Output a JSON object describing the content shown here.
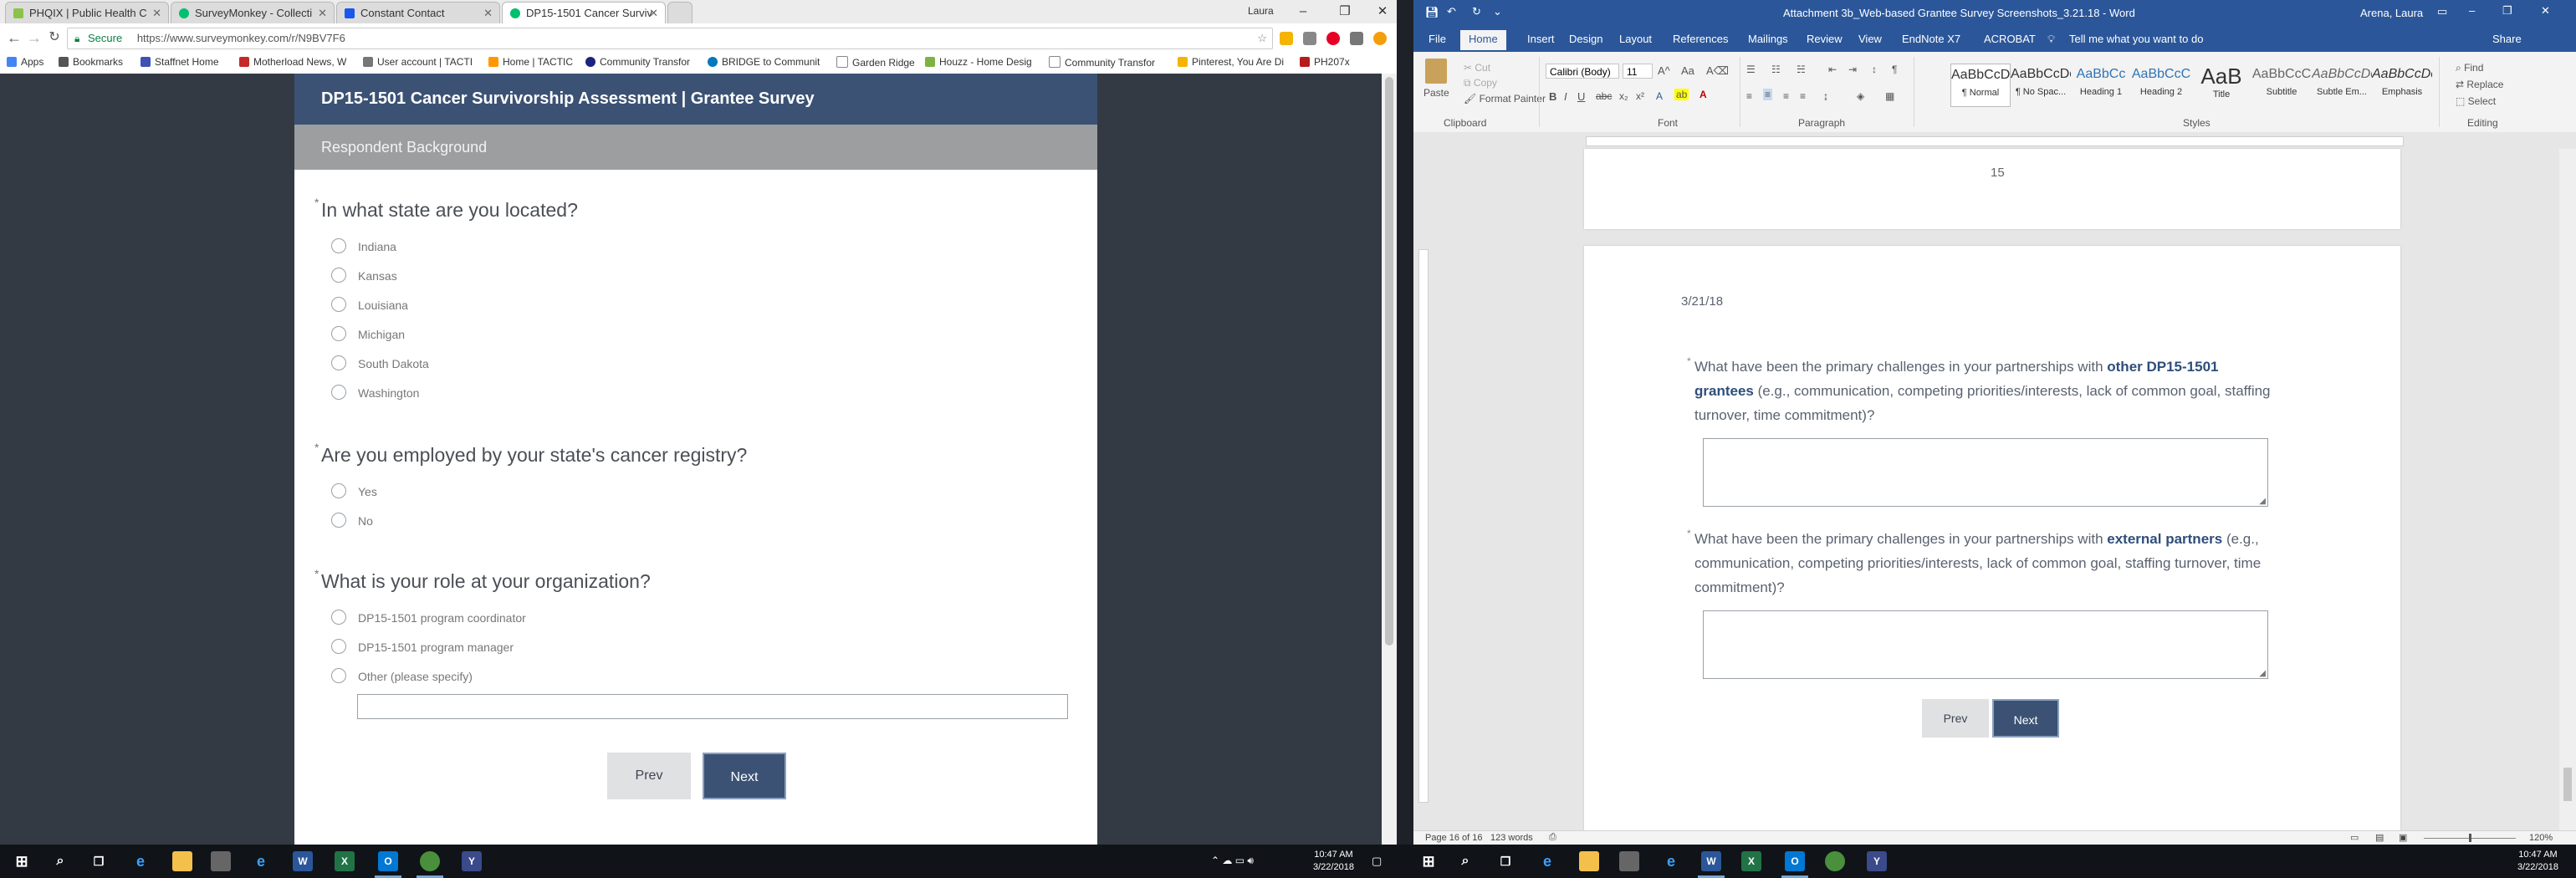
{
  "chrome": {
    "profile": "Laura",
    "tabs": [
      {
        "title": "PHQIX | Public Health C",
        "color": "#8bc34a"
      },
      {
        "title": "SurveyMonkey - Collecti",
        "color": "#00bf6f"
      },
      {
        "title": "Constant Contact",
        "color": "#1856ed"
      },
      {
        "title": "DP15-1501 Cancer Surviv",
        "color": "#00bf6f"
      }
    ],
    "secure_label": "Secure",
    "url": "https://www.surveymonkey.com/r/N9BV7F6",
    "apps_label": "Apps",
    "bookmarks": [
      "Bookmarks",
      "Staffnet Home",
      "Motherload News, W",
      "User account | TACTI",
      "Home | TACTIC",
      "Community Transfor",
      "BRIDGE to Communit",
      "Garden Ridge",
      "Houzz - Home Desig",
      "Community Transfor",
      "Pinterest, You Are Di",
      "PH207x"
    ]
  },
  "survey": {
    "title": "DP15-1501 Cancer Survivorship Assessment | Grantee Survey",
    "section": "Respondent Background",
    "questions": [
      {
        "text": "In what state are you located?",
        "options": [
          "Indiana",
          "Kansas",
          "Louisiana",
          "Michigan",
          "South Dakota",
          "Washington"
        ]
      },
      {
        "text": "Are you employed by your state's cancer registry?",
        "options": [
          "Yes",
          "No"
        ]
      },
      {
        "text": "What is your role at your organization?",
        "options": [
          "DP15-1501 program coordinator",
          "DP15-1501 program manager",
          "Other (please specify)"
        ]
      }
    ],
    "prev_label": "Prev",
    "next_label": "Next"
  },
  "word": {
    "title": "Attachment 3b_Web-based Grantee Survey Screenshots_3.21.18  -  Word",
    "user": "Arena, Laura",
    "tabs": [
      "File",
      "Home",
      "Insert",
      "Design",
      "Layout",
      "References",
      "Mailings",
      "Review",
      "View",
      "EndNote X7",
      "ACROBAT"
    ],
    "tell_me": "Tell me what you want to do",
    "share": "Share",
    "clipboard": {
      "paste": "Paste",
      "cut": "Cut",
      "copy": "Copy",
      "format_painter": "Format Painter",
      "label": "Clipboard"
    },
    "font": {
      "name": "Calibri (Body)",
      "size": "11",
      "label": "Font"
    },
    "paragraph_label": "Paragraph",
    "styles": [
      {
        "sample": "AaBbCcDc",
        "name": "¶ Normal"
      },
      {
        "sample": "AaBbCcDc",
        "name": "¶ No Spac..."
      },
      {
        "sample": "AaBbCc",
        "name": "Heading 1"
      },
      {
        "sample": "AaBbCcC",
        "name": "Heading 2"
      },
      {
        "sample": "AaB",
        "name": "Title"
      },
      {
        "sample": "AaBbCcC",
        "name": "Subtitle"
      },
      {
        "sample": "AaBbCcDc",
        "name": "Subtle Em..."
      },
      {
        "sample": "AaBbCcDc",
        "name": "Emphasis"
      }
    ],
    "styles_label": "Styles",
    "editing": {
      "find": "Find",
      "replace": "Replace",
      "select": "Select",
      "label": "Editing"
    },
    "page_number": "15",
    "date": "3/21/18",
    "q1": {
      "pre": "What have been the primary challenges in your partnerships with ",
      "bold": "other DP15-1501 grantees",
      "post": " (e.g., communication, competing priorities/interests, lack of common goal, staffing turnover, time commitment)?"
    },
    "q2": {
      "pre": "What have been the primary challenges in your partnerships with ",
      "bold": "external partners",
      "post": " (e.g., communication, competing priorities/interests, lack of common goal, staffing turnover, time commitment)?"
    },
    "prev_label": "Prev",
    "next_label": "Next",
    "status": {
      "page": "Page 16 of 16",
      "words": "123 words",
      "zoom": "120%"
    }
  },
  "taskbar": {
    "left_time": "10:47 AM",
    "left_date": "3/22/2018",
    "right_time": "10:47 AM",
    "right_date": "3/22/2018"
  }
}
